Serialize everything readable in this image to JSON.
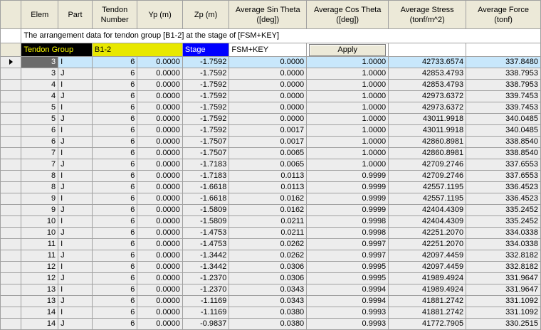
{
  "columns": [
    "Elem",
    "Part",
    "Tendon Number",
    "Yp (m)",
    "Zp (m)",
    "Average Sin Theta ([deg])",
    "Average Cos Theta ([deg])",
    "Average Stress (tonf/m^2)",
    "Average Force (tonf)"
  ],
  "info_text": "The arrangement data for tendon group [B1-2] at the stage of [FSM+KEY]",
  "controls": {
    "tendon_group_label": "Tendon Group",
    "tendon_group_value": "B1-2",
    "stage_label": "Stage",
    "stage_value": "FSM+KEY",
    "apply_label": "Apply"
  },
  "rows": [
    [
      "3",
      "I",
      "6",
      "0.0000",
      "-1.7592",
      "0.0000",
      "1.0000",
      "42733.6574",
      "337.8480"
    ],
    [
      "3",
      "J",
      "6",
      "0.0000",
      "-1.7592",
      "0.0000",
      "1.0000",
      "42853.4793",
      "338.7953"
    ],
    [
      "4",
      "I",
      "6",
      "0.0000",
      "-1.7592",
      "0.0000",
      "1.0000",
      "42853.4793",
      "338.7953"
    ],
    [
      "4",
      "J",
      "6",
      "0.0000",
      "-1.7592",
      "0.0000",
      "1.0000",
      "42973.6372",
      "339.7453"
    ],
    [
      "5",
      "I",
      "6",
      "0.0000",
      "-1.7592",
      "0.0000",
      "1.0000",
      "42973.6372",
      "339.7453"
    ],
    [
      "5",
      "J",
      "6",
      "0.0000",
      "-1.7592",
      "0.0000",
      "1.0000",
      "43011.9918",
      "340.0485"
    ],
    [
      "6",
      "I",
      "6",
      "0.0000",
      "-1.7592",
      "0.0017",
      "1.0000",
      "43011.9918",
      "340.0485"
    ],
    [
      "6",
      "J",
      "6",
      "0.0000",
      "-1.7507",
      "0.0017",
      "1.0000",
      "42860.8981",
      "338.8540"
    ],
    [
      "7",
      "I",
      "6",
      "0.0000",
      "-1.7507",
      "0.0065",
      "1.0000",
      "42860.8981",
      "338.8540"
    ],
    [
      "7",
      "J",
      "6",
      "0.0000",
      "-1.7183",
      "0.0065",
      "1.0000",
      "42709.2746",
      "337.6553"
    ],
    [
      "8",
      "I",
      "6",
      "0.0000",
      "-1.7183",
      "0.0113",
      "0.9999",
      "42709.2746",
      "337.6553"
    ],
    [
      "8",
      "J",
      "6",
      "0.0000",
      "-1.6618",
      "0.0113",
      "0.9999",
      "42557.1195",
      "336.4523"
    ],
    [
      "9",
      "I",
      "6",
      "0.0000",
      "-1.6618",
      "0.0162",
      "0.9999",
      "42557.1195",
      "336.4523"
    ],
    [
      "9",
      "J",
      "6",
      "0.0000",
      "-1.5809",
      "0.0162",
      "0.9999",
      "42404.4309",
      "335.2452"
    ],
    [
      "10",
      "I",
      "6",
      "0.0000",
      "-1.5809",
      "0.0211",
      "0.9998",
      "42404.4309",
      "335.2452"
    ],
    [
      "10",
      "J",
      "6",
      "0.0000",
      "-1.4753",
      "0.0211",
      "0.9998",
      "42251.2070",
      "334.0338"
    ],
    [
      "11",
      "I",
      "6",
      "0.0000",
      "-1.4753",
      "0.0262",
      "0.9997",
      "42251.2070",
      "334.0338"
    ],
    [
      "11",
      "J",
      "6",
      "0.0000",
      "-1.3442",
      "0.0262",
      "0.9997",
      "42097.4459",
      "332.8182"
    ],
    [
      "12",
      "I",
      "6",
      "0.0000",
      "-1.3442",
      "0.0306",
      "0.9995",
      "42097.4459",
      "332.8182"
    ],
    [
      "12",
      "J",
      "6",
      "0.0000",
      "-1.2370",
      "0.0306",
      "0.9995",
      "41989.4924",
      "331.9647"
    ],
    [
      "13",
      "I",
      "6",
      "0.0000",
      "-1.2370",
      "0.0343",
      "0.9994",
      "41989.4924",
      "331.9647"
    ],
    [
      "13",
      "J",
      "6",
      "0.0000",
      "-1.1169",
      "0.0343",
      "0.9994",
      "41881.2742",
      "331.1092"
    ],
    [
      "14",
      "I",
      "6",
      "0.0000",
      "-1.1169",
      "0.0380",
      "0.9993",
      "41881.2742",
      "331.1092"
    ],
    [
      "14",
      "J",
      "6",
      "0.0000",
      "-0.9837",
      "0.0380",
      "0.9993",
      "41772.7905",
      "330.2515"
    ]
  ],
  "current_row": 0
}
